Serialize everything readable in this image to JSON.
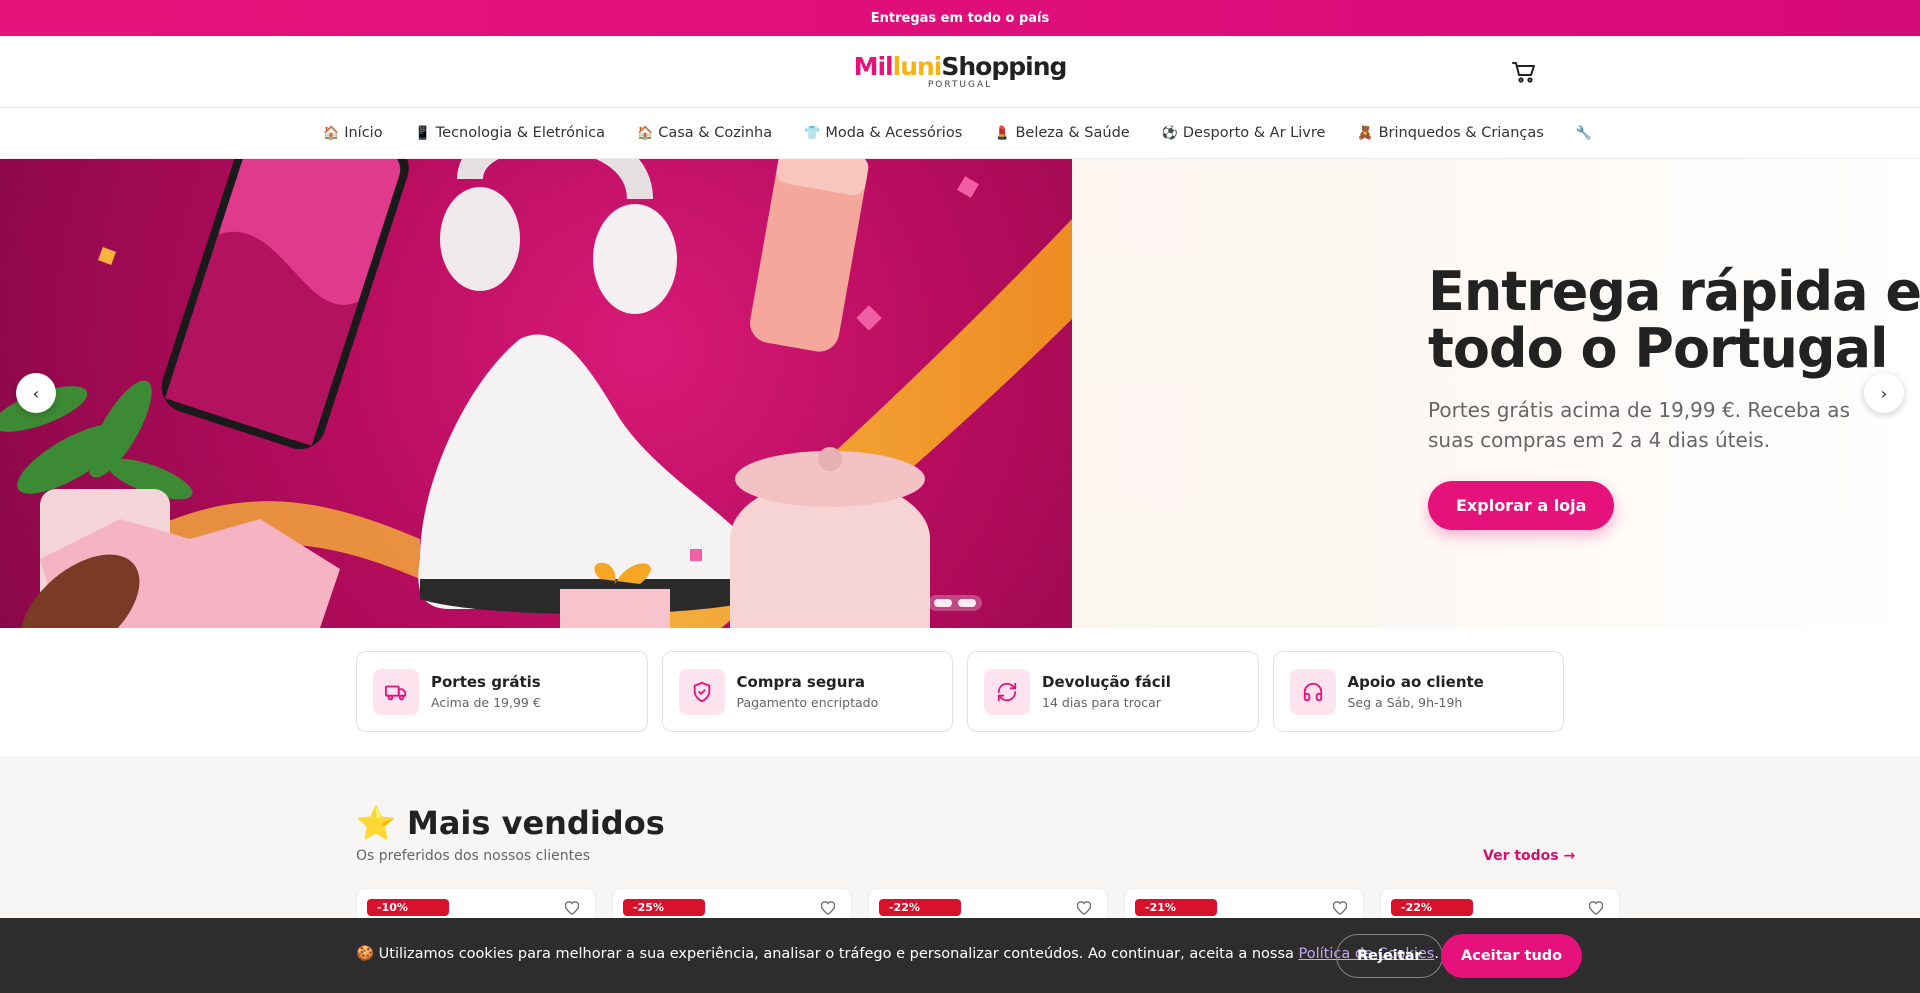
{
  "topbar": {
    "text": "Entregas em todo o país"
  },
  "header": {
    "logo_part1": "Mil",
    "logo_part2": "luni",
    "logo_part3": "Shopping",
    "logo_sub": "PORTUGAL",
    "cart_icon": "cart-icon"
  },
  "nav": {
    "items": [
      {
        "emoji": "🏠",
        "label": "Início"
      },
      {
        "emoji": "📱",
        "label": "Tecnologia & Eletrónica"
      },
      {
        "emoji": "🏠",
        "label": "Casa & Cozinha"
      },
      {
        "emoji": "👕",
        "label": "Moda & Acessórios"
      },
      {
        "emoji": "💄",
        "label": "Beleza & Saúde"
      },
      {
        "emoji": "⚽",
        "label": "Desporto & Ar Livre"
      },
      {
        "emoji": "🧸",
        "label": "Brinquedos & Crianças"
      },
      {
        "emoji": "🔧",
        "label": ""
      }
    ]
  },
  "hero": {
    "title_line1": "Entrega rápida em",
    "title_line2": "todo o Portugal",
    "subtitle": "Portes grátis acima de 19,99 €. Receba as suas compras em 2 a 4 dias úteis.",
    "button": "Explorar a loja",
    "slides": 2
  },
  "features": [
    {
      "icon": "truck-icon",
      "title": "Portes grátis",
      "sub": "Acima de 19,99 €"
    },
    {
      "icon": "shield-icon",
      "title": "Compra segura",
      "sub": "Pagamento encriptado"
    },
    {
      "icon": "refresh-icon",
      "title": "Devolução fácil",
      "sub": "14 dias para trocar"
    },
    {
      "icon": "headphones-icon",
      "title": "Apoio ao cliente",
      "sub": "Seg a Sáb, 9h-19h"
    }
  ],
  "bestsellers": {
    "title": "⭐ Mais vendidos",
    "subtitle": "Os preferidos dos nossos clientes",
    "link": "Ver todos →",
    "discounts": [
      "-10%",
      "-25%",
      "-22%",
      "-21%",
      "-22%"
    ]
  },
  "cookie": {
    "text_before": "🍪 Utilizamos cookies para melhorar a sua experiência, analisar o tráfego e personalizar conteúdos. Ao continuar, aceita a nossa ",
    "link": "Política de Cookies",
    "text_after": ".",
    "reject": "Rejeitar",
    "accept": "Aceitar tudo"
  },
  "colors": {
    "accent": "#e6127b",
    "badge": "#d8112c",
    "yellow": "#f5b31a"
  }
}
